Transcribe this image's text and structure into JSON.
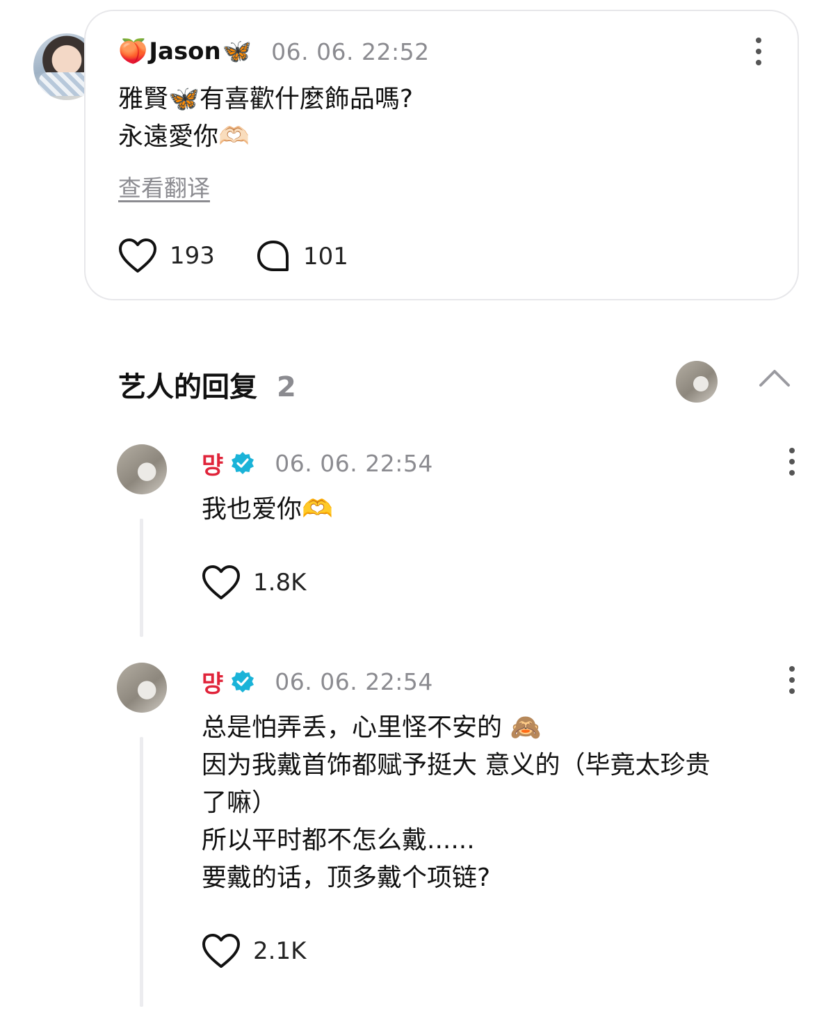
{
  "post": {
    "author_prefix_emoji": "🍑",
    "author_name": "Jason",
    "author_suffix_emoji": "🦋",
    "timestamp": "06. 06. 22:52",
    "text_line1": "雅賢🦋有喜歡什麼飾品嗎?",
    "text_line2": "永遠愛你🫶🏻",
    "translate_label": "查看翻译",
    "likes": "193",
    "comments": "101"
  },
  "artist_replies": {
    "title": "艺人的回复",
    "count": "2",
    "replies": [
      {
        "author": "먕",
        "timestamp": "06. 06. 22:54",
        "lines": [
          "我也爱你🫶"
        ],
        "likes": "1.8K"
      },
      {
        "author": "먕",
        "timestamp": "06. 06. 22:54",
        "lines": [
          "总是怕弄丢，心里怪不安的 🙈",
          "因为我戴首饰都赋予挺大 意义的（毕竟太珍贵",
          "了嘛）",
          "所以平时都不怎么戴......",
          "要戴的话，顶多戴个项链?"
        ],
        "likes": "2.1K"
      }
    ]
  },
  "icons": {
    "like": "heart-outline-icon",
    "comment": "speech-bubble-icon",
    "more": "vertical-dots-icon",
    "verified": "verified-badge-icon",
    "collapse": "chevron-up-icon"
  },
  "colors": {
    "artist_name": "#e0243a",
    "verified": "#1ab3d8",
    "muted_text": "#8b8b90",
    "card_border": "#e7e7ea"
  }
}
